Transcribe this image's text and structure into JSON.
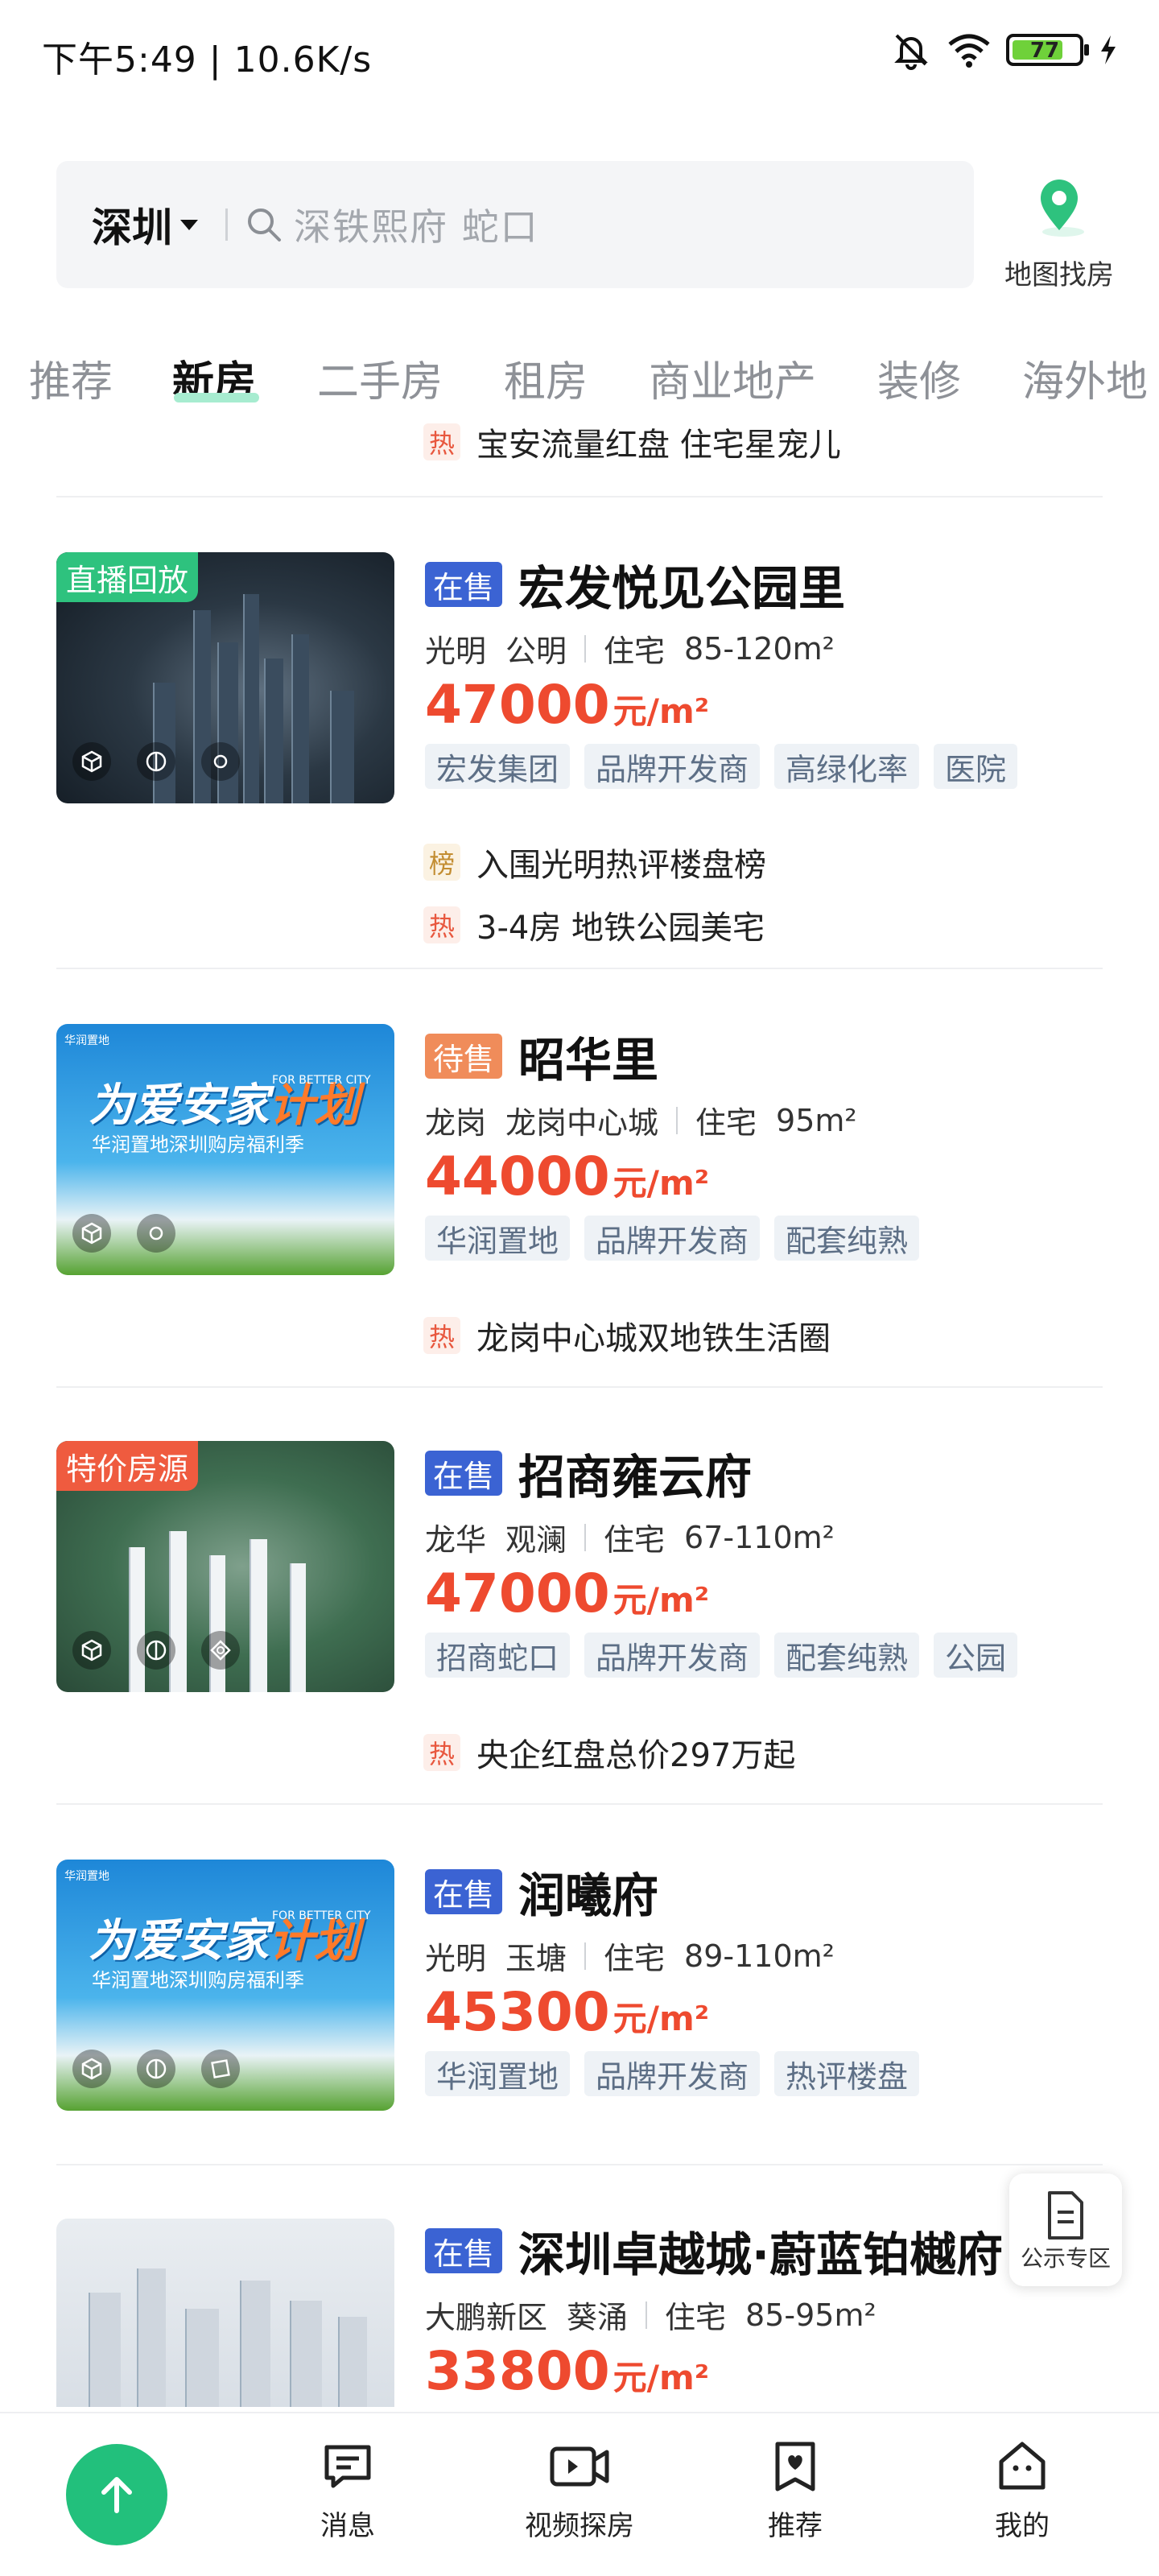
{
  "status_bar": {
    "time": "下午5:49 | 10.6K/s",
    "battery": "77"
  },
  "search": {
    "city": "深圳",
    "placeholder": "深铁熙府 蛇口",
    "map_label": "地图找房"
  },
  "tabs": [
    "推荐",
    "新房",
    "二手房",
    "租房",
    "商业地产",
    "装修",
    "海外地"
  ],
  "active_tab": "新房",
  "top_partial": {
    "tag": "热",
    "text": "宝安流量红盘 住宅星宠儿"
  },
  "listings": [
    {
      "badge": "直播回放",
      "status": "在售",
      "name": "宏发悦见公园里",
      "district": "光明",
      "area": "公明",
      "type": "住宅",
      "size": "85-120m²",
      "price": "47000",
      "unit": "元/m²",
      "tags": [
        "宏发集团",
        "品牌开发商",
        "高绿化率",
        "医院"
      ],
      "notes": [
        {
          "kind": "榜",
          "text": "入围光明热评楼盘榜"
        },
        {
          "kind": "热",
          "text": "3-4房 地铁公园美宅"
        }
      ]
    },
    {
      "status": "待售",
      "name": "昭华里",
      "district": "龙岗",
      "area": "龙岗中心城",
      "type": "住宅",
      "size": "95m²",
      "price": "44000",
      "unit": "元/m²",
      "tags": [
        "华润置地",
        "品牌开发商",
        "配套纯熟"
      ],
      "notes": [
        {
          "kind": "热",
          "text": "龙岗中心城双地铁生活圈"
        }
      ],
      "ad": {
        "title_a": "为爱安家",
        "title_b": "计划",
        "subtitle": "华润置地深圳购房福利季",
        "english": "FOR BETTER CITY"
      }
    },
    {
      "badge": "特价房源",
      "status": "在售",
      "name": "招商雍云府",
      "district": "龙华",
      "area": "观澜",
      "type": "住宅",
      "size": "67-110m²",
      "price": "47000",
      "unit": "元/m²",
      "tags": [
        "招商蛇口",
        "品牌开发商",
        "配套纯熟",
        "公园"
      ],
      "notes": [
        {
          "kind": "热",
          "text": "央企红盘总价297万起"
        }
      ]
    },
    {
      "status": "在售",
      "name": "润曦府",
      "district": "光明",
      "area": "玉塘",
      "type": "住宅",
      "size": "89-110m²",
      "price": "45300",
      "unit": "元/m²",
      "tags": [
        "华润置地",
        "品牌开发商",
        "热评楼盘"
      ],
      "ad": {
        "title_a": "为爱安家",
        "title_b": "计划",
        "subtitle": "华润置地深圳购房福利季",
        "english": "FOR BETTER CITY"
      }
    },
    {
      "status": "在售",
      "name": "深圳卓越城·蔚蓝铂樾府",
      "district": "大鹏新区",
      "area": "葵涌",
      "type": "住宅",
      "size": "85-95m²",
      "price": "33800",
      "unit": "元/m²"
    }
  ],
  "floating": {
    "label": "公示专区"
  },
  "bottom_nav": [
    {
      "label": "消息",
      "icon": "message-icon"
    },
    {
      "label": "视频探房",
      "icon": "video-icon"
    },
    {
      "label": "推荐",
      "icon": "recommend-icon"
    },
    {
      "label": "我的",
      "icon": "profile-icon"
    }
  ]
}
